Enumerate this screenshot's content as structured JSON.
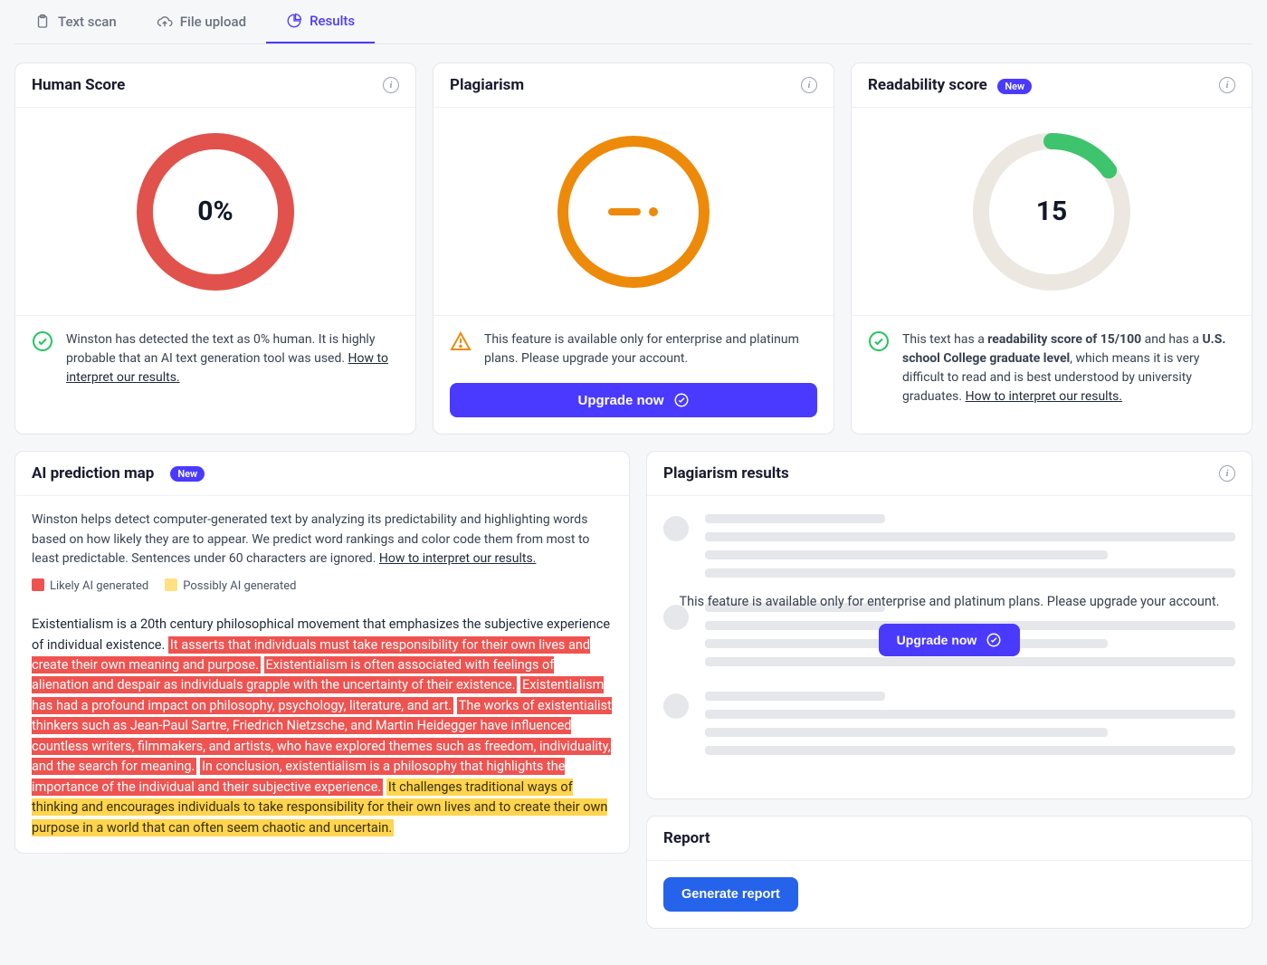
{
  "tabs": {
    "text_scan": "Text scan",
    "file_upload": "File upload",
    "results": "Results"
  },
  "human_score": {
    "title": "Human Score",
    "value_text": "0%",
    "footer_text_a": "Winston has detected the text as 0% human. It is highly probable that an AI text generation tool was used. ",
    "footer_link": "How to interpret our results."
  },
  "plagiarism": {
    "title": "Plagiarism",
    "footer_text": "This feature is available only for enterprise and platinum plans. Please upgrade your account.",
    "upgrade_label": "Upgrade now"
  },
  "readability": {
    "title": "Readability score",
    "new_badge": "New",
    "value_text": "15",
    "footer_text_a": "This text has a ",
    "footer_bold_a": "readability score of 15/100",
    "footer_text_b": " and has a ",
    "footer_bold_b": "U.S. school College graduate level",
    "footer_text_c": ", which means it is very difficult to read and is best understood by university graduates. ",
    "footer_link": "How to interpret our results."
  },
  "ai_map": {
    "title": "AI prediction map",
    "new_badge": "New",
    "description": "Winston helps detect computer-generated text by analyzing its predictability and highlighting words based on how likely they are to appear. We predict word rankings and color code them from most to least predictable. Sentences under 60 characters are ignored. ",
    "link": "How to interpret our results.",
    "legend_likely": "Likely AI generated",
    "legend_possibly": "Possibly AI generated",
    "segments": [
      {
        "cls": "",
        "text": "Existentialism is a 20th century philosophical movement that emphasizes the subjective experience of individual existence. "
      },
      {
        "cls": "hl-red",
        "text": "It asserts that individuals must take responsibility for their own lives and create their own meaning and purpose."
      },
      {
        "cls": "",
        "text": " "
      },
      {
        "cls": "hl-red",
        "text": "Existentialism is often associated with feelings of alienation and despair as individuals grapple with the uncertainty of their existence."
      },
      {
        "cls": "",
        "text": " "
      },
      {
        "cls": "hl-red",
        "text": "Existentialism has had a profound impact on philosophy, psychology, literature, and art."
      },
      {
        "cls": "",
        "text": " "
      },
      {
        "cls": "hl-red",
        "text": "The works of existentialist thinkers such as Jean-Paul Sartre, Friedrich Nietzsche, and Martin Heidegger have influenced countless writers, filmmakers, and artists, who have explored themes such as freedom, individuality, and the search for meaning."
      },
      {
        "cls": "",
        "text": " "
      },
      {
        "cls": "hl-red",
        "text": "In conclusion, existentialism is a philosophy that highlights the importance of the individual and their subjective experience."
      },
      {
        "cls": "",
        "text": " "
      },
      {
        "cls": "hl-yellow",
        "text": "It challenges traditional ways of thinking and encourages individuals to take responsibility for their own lives and to create their own purpose in a world that can often seem chaotic and uncertain."
      }
    ]
  },
  "plag_results": {
    "title": "Plagiarism results",
    "overlay_text": "This feature is available only for enterprise and platinum plans. Please upgrade your account.",
    "upgrade_label": "Upgrade now"
  },
  "report": {
    "title": "Report",
    "generate_label": "Generate report"
  },
  "colors": {
    "accent": "#4a3aff",
    "human_ring": "#e1524c",
    "plag_ring": "#ed8a0a",
    "readability_ring": "#3ec46d",
    "ring_bg": "#ece8e1"
  },
  "chart_data": [
    {
      "type": "pie",
      "title": "Human Score",
      "series": [
        {
          "name": "Human",
          "values": [
            0
          ]
        }
      ],
      "categories": [
        "Human %"
      ],
      "ylim": [
        0,
        100
      ],
      "display": "0%"
    },
    {
      "type": "pie",
      "title": "Readability score",
      "series": [
        {
          "name": "Readability",
          "values": [
            15
          ]
        }
      ],
      "categories": [
        "Score"
      ],
      "ylim": [
        0,
        100
      ],
      "display": "15"
    }
  ]
}
